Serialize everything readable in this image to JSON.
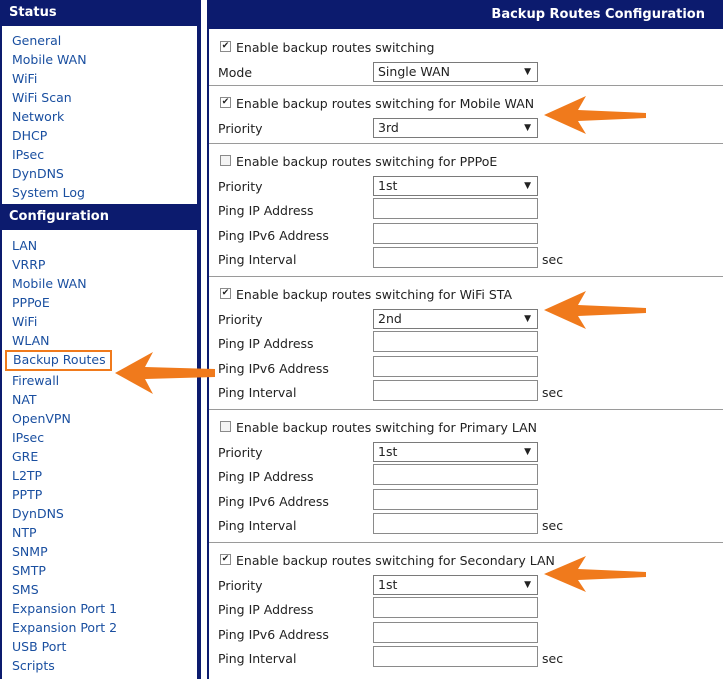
{
  "sidebar": {
    "status_title": "Status",
    "status_items": [
      "General",
      "Mobile WAN",
      "WiFi",
      "WiFi Scan",
      "Network",
      "DHCP",
      "IPsec",
      "DynDNS",
      "System Log"
    ],
    "config_title": "Configuration",
    "config_items": [
      "LAN",
      "VRRP",
      "Mobile WAN",
      "PPPoE",
      "WiFi",
      "WLAN",
      "Backup Routes",
      "Firewall",
      "NAT",
      "OpenVPN",
      "IPsec",
      "GRE",
      "L2TP",
      "PPTP",
      "DynDNS",
      "NTP",
      "SNMP",
      "SMTP",
      "SMS",
      "Expansion Port 1",
      "Expansion Port 2",
      "USB Port",
      "Scripts"
    ],
    "active_item": "Backup Routes"
  },
  "main": {
    "title": "Backup Routes Configuration",
    "general": {
      "enable_label": "Enable backup routes switching",
      "enabled": true,
      "mode_label": "Mode",
      "mode_value": "Single WAN"
    },
    "labels": {
      "priority": "Priority",
      "ping_ip": "Ping IP Address",
      "ping_ipv6": "Ping IPv6 Address",
      "ping_interval": "Ping Interval",
      "sec": "sec"
    },
    "mobile_wan": {
      "enable_label": "Enable backup routes switching for Mobile WAN",
      "enabled": true,
      "priority": "3rd"
    },
    "pppoe": {
      "enable_label": "Enable backup routes switching for PPPoE",
      "enabled": false,
      "priority": "1st"
    },
    "wifi_sta": {
      "enable_label": "Enable backup routes switching for WiFi STA",
      "enabled": true,
      "priority": "2nd"
    },
    "primary_lan": {
      "enable_label": "Enable backup routes switching for Primary LAN",
      "enabled": false,
      "priority": "1st"
    },
    "secondary_lan": {
      "enable_label": "Enable backup routes switching for Secondary LAN",
      "enabled": true,
      "priority": "1st"
    }
  },
  "colors": {
    "header": "#0c1b6e",
    "link": "#1a4fa0",
    "arrow": "#f07a1c"
  },
  "icons": {
    "check": "checkmark-icon",
    "dropdown": "chevron-down-icon",
    "annotation": "orange-arrow-icon"
  }
}
